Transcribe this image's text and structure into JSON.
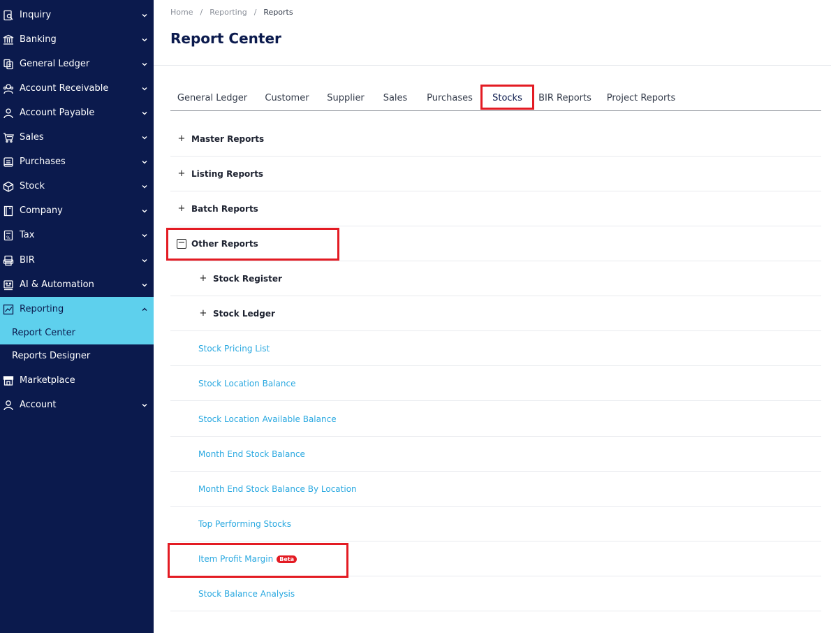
{
  "sidebar": {
    "items": [
      {
        "label": "Inquiry",
        "icon": "search-doc-icon"
      },
      {
        "label": "Banking",
        "icon": "bank-icon"
      },
      {
        "label": "General Ledger",
        "icon": "ledger-icon"
      },
      {
        "label": "Account Receivable",
        "icon": "receivable-icon"
      },
      {
        "label": "Account Payable",
        "icon": "payable-icon"
      },
      {
        "label": "Sales",
        "icon": "cart-icon"
      },
      {
        "label": "Purchases",
        "icon": "purchases-icon"
      },
      {
        "label": "Stock",
        "icon": "box-icon"
      },
      {
        "label": "Company",
        "icon": "company-icon"
      },
      {
        "label": "Tax",
        "icon": "tax-icon"
      },
      {
        "label": "BIR",
        "icon": "bir-icon"
      },
      {
        "label": "AI & Automation",
        "icon": "robot-icon"
      },
      {
        "label": "Reporting",
        "icon": "chart-icon"
      },
      {
        "label": "Marketplace",
        "icon": "store-icon"
      },
      {
        "label": "Account",
        "icon": "user-icon"
      }
    ],
    "reporting_sub": [
      "Report Center",
      "Reports Designer"
    ]
  },
  "breadcrumb": [
    "Home",
    "Reporting",
    "Reports"
  ],
  "page_title": "Report Center",
  "tabs": [
    "General Ledger",
    "Customer",
    "Supplier",
    "Sales",
    "Purchases",
    "Stocks",
    "BIR Reports",
    "Project Reports"
  ],
  "active_tab": "Stocks",
  "sections": [
    {
      "title": "Master Reports",
      "toggle": "+"
    },
    {
      "title": "Listing Reports",
      "toggle": "+"
    },
    {
      "title": "Batch Reports",
      "toggle": "+"
    },
    {
      "title": "Other Reports",
      "toggle": "−"
    }
  ],
  "other_reports": {
    "groups": [
      {
        "title": "Stock Register",
        "toggle": "+"
      },
      {
        "title": "Stock Ledger",
        "toggle": "+"
      }
    ],
    "links": [
      "Stock Pricing List",
      "Stock Location Balance",
      "Stock Location Available Balance",
      "Month End Stock Balance",
      "Month End Stock Balance By Location",
      "Top Performing Stocks",
      "Item Profit Margin",
      "Stock Balance Analysis"
    ],
    "beta_badge": "Beta"
  },
  "colors": {
    "sidebar_bg": "#0b1a4d",
    "active_bg": "#5ed0ed",
    "link": "#29a8e0",
    "highlight": "#e31b23"
  }
}
